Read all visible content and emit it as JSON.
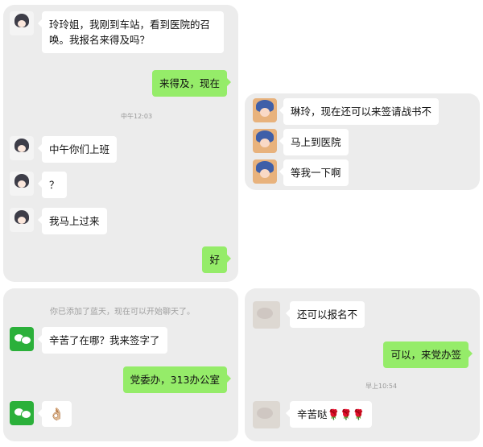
{
  "panel1": {
    "msg1": "玲玲姐，我刚到车站，看到医院的召唤。我报名来得及吗？",
    "reply1": "来得及，现在",
    "time": "中午12:03",
    "msg2": "中午你们上班",
    "msg3": "？",
    "msg4": "我马上过来",
    "reply2": "好"
  },
  "panel2": {
    "msg1": "琳玲，现在还可以来签请战书不",
    "msg2": "马上到医院",
    "msg3": "等我一下啊"
  },
  "panel3": {
    "system": "你已添加了蓝天，现在可以开始聊天了。",
    "msg1": "辛苦了在哪？我来签字了",
    "reply1": "党委办，313办公室",
    "emoji": "👌🏼"
  },
  "panel4": {
    "msg1": "还可以报名不",
    "reply1": "可以，来党办签",
    "time": "早上10:54",
    "msg2": "辛苦哒🌹🌹🌹"
  }
}
